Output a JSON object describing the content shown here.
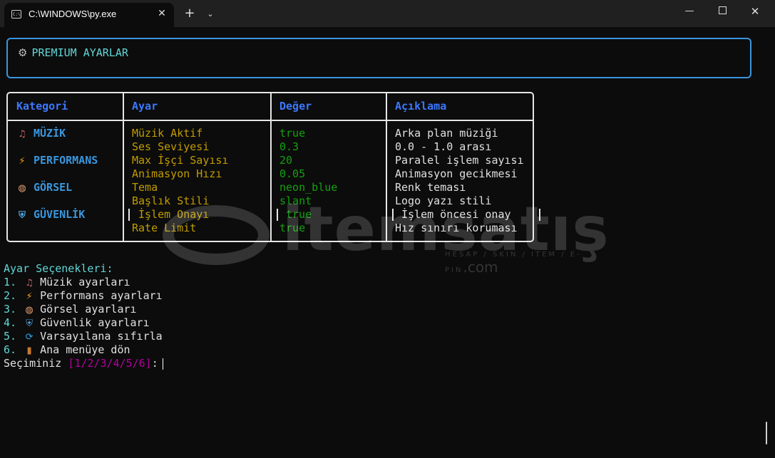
{
  "window": {
    "tab_title": "C:\\WINDOWS\\py.exe",
    "tab_icon": "terminal-icon",
    "close_tab_glyph": "✕",
    "new_tab_glyph": "+",
    "tab_menu_glyph": "⌄",
    "minimize_glyph": "—",
    "close_glyph": "✕"
  },
  "panel": {
    "icon": "gear-icon",
    "icon_glyph": "⚙",
    "title": "PREMIUM AYARLAR",
    "border_color": "#3a96dd"
  },
  "table": {
    "headers": {
      "kategori": "Kategori",
      "ayar": "Ayar",
      "deger": "Değer",
      "aciklama": "Açıklama"
    },
    "categories": [
      {
        "icon": "music-note-icon",
        "glyph": "♫",
        "color": "#c86464",
        "label": "MÜZİK"
      },
      {
        "icon": "lightning-icon",
        "glyph": "⚡",
        "color": "#f7a21b",
        "label": "PERFORMANS"
      },
      {
        "icon": "palette-icon",
        "glyph": "◍",
        "color": "#e8a070",
        "label": "GÖRSEL"
      },
      {
        "icon": "shield-icon",
        "glyph": "⛨",
        "color": "#4fa3e0",
        "label": "GÜVENLİK"
      }
    ],
    "rows": [
      {
        "ayar": "Müzik Aktif",
        "deger": "true",
        "aciklama": "Arka plan müziği"
      },
      {
        "ayar": "Ses Seviyesi",
        "deger": "0.3",
        "aciklama": "0.0 - 1.0 arası"
      },
      {
        "ayar": "Max İşçi Sayısı",
        "deger": "20",
        "aciklama": "Paralel işlem sayısı"
      },
      {
        "ayar": "Animasyon Hızı",
        "deger": "0.05",
        "aciklama": "Animasyon gecikmesi"
      },
      {
        "ayar": "Tema",
        "deger": "neon_blue",
        "aciklama": "Renk teması"
      },
      {
        "ayar": "Başlık Stili",
        "deger": "slant",
        "aciklama": "Logo yazı stili"
      },
      {
        "ayar": "İşlem Onayı",
        "deger": "true",
        "aciklama": "İşlem öncesi onay"
      },
      {
        "ayar": "Rate Limit",
        "deger": "true",
        "aciklama": "Hız sınırı koruması"
      }
    ]
  },
  "watermark": {
    "brand": "itemsatış",
    "tagline": "HESAP / SKIN / ITEM / E-PIN",
    "domain": ".com"
  },
  "menu": {
    "title": "Ayar Seçenekleri:",
    "options": [
      {
        "num": "1.",
        "icon": "music-note-icon",
        "glyph": "♫",
        "color": "#c86464",
        "label": "Müzik ayarları"
      },
      {
        "num": "2.",
        "icon": "lightning-icon",
        "glyph": "⚡",
        "color": "#f7a21b",
        "label": "Performans ayarları"
      },
      {
        "num": "3.",
        "icon": "palette-icon",
        "glyph": "◍",
        "color": "#e8a070",
        "label": "Görsel ayarları"
      },
      {
        "num": "4.",
        "icon": "shield-icon",
        "glyph": "⛨",
        "color": "#4fa3e0",
        "label": "Güvenlik ayarları"
      },
      {
        "num": "5.",
        "icon": "refresh-icon",
        "glyph": "⟳",
        "color": "#2aa5e8",
        "label": "Varsayılana sıfırla"
      },
      {
        "num": "6.",
        "icon": "door-icon",
        "glyph": "▮",
        "color": "#c97a2e",
        "label": "Ana menüye dön"
      }
    ],
    "prompt": "Seçiminiz ",
    "choices": "[1/2/3/4/5/6]",
    "prompt_suffix": ":"
  }
}
